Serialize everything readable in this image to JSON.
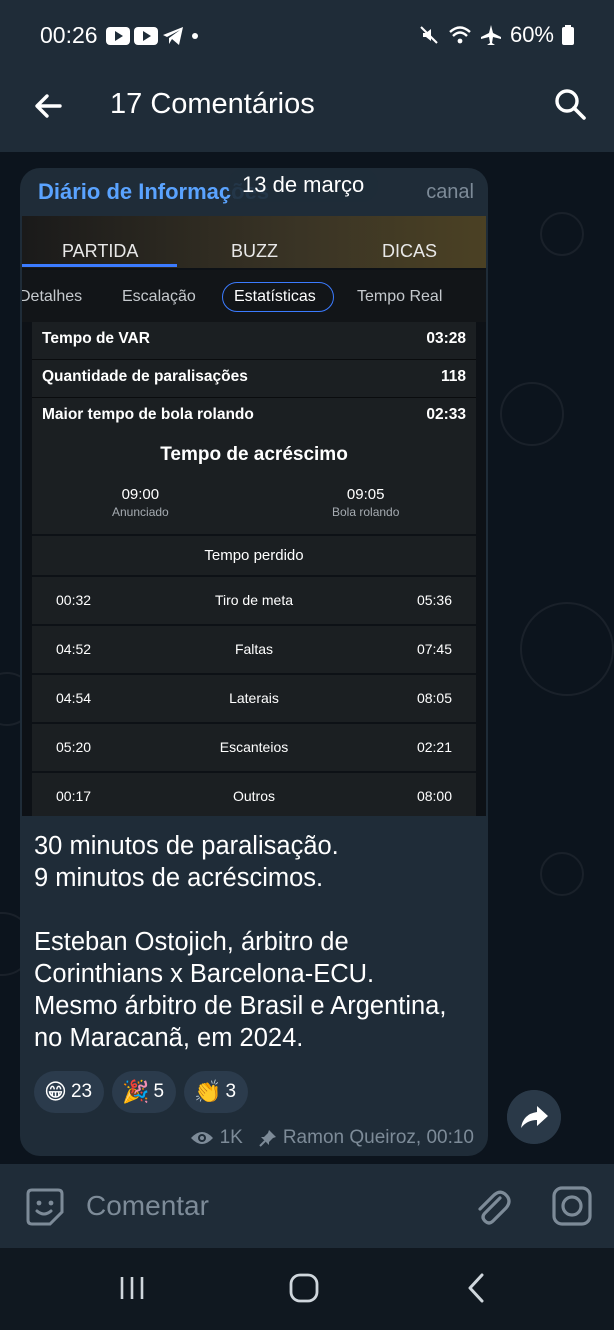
{
  "status_bar": {
    "time": "00:26",
    "battery": "60%"
  },
  "header": {
    "title": "17 Comentários"
  },
  "post": {
    "channel_name": "Diário de Informações",
    "channel_tag": "canal",
    "date_pill": "13 de março",
    "screenshot": {
      "tabs": [
        "PARTIDA",
        "BUZZ",
        "DICAS"
      ],
      "subtabs": [
        "Detalhes",
        "Escalação",
        "Estatísticas",
        "Tempo Real"
      ],
      "stats": [
        {
          "label": "Tempo de VAR",
          "value": "03:28"
        },
        {
          "label": "Quantidade de paralisações",
          "value": "118"
        },
        {
          "label": "Maior tempo de bola rolando",
          "value": "02:33"
        }
      ],
      "extra_title": "Tempo de acréscimo",
      "announced_value": "09:00",
      "announced_label": "Anunciado",
      "rolling_value": "09:05",
      "rolling_label": "Bola rolando",
      "lost_title": "Tempo perdido",
      "lost_rows": [
        {
          "a": "00:32",
          "label": "Tiro de meta",
          "b": "05:36"
        },
        {
          "a": "04:52",
          "label": "Faltas",
          "b": "07:45"
        },
        {
          "a": "04:54",
          "label": "Laterais",
          "b": "08:05"
        },
        {
          "a": "05:20",
          "label": "Escanteios",
          "b": "02:21"
        },
        {
          "a": "00:17",
          "label": "Outros",
          "b": "08:00"
        }
      ]
    },
    "caption": {
      "line1": "30 minutos de paralisação.",
      "line2": "9 minutos de acréscimos.",
      "line3": "Esteban Ostojich, árbitro de",
      "line4": "Corinthians x Barcelona-ECU.",
      "line5": "Mesmo árbitro de Brasil e Argentina,",
      "line6": "no Maracanã, em 2024."
    },
    "reactions": [
      {
        "emoji": "😁",
        "count": "23"
      },
      {
        "emoji": "🎉",
        "count": "5"
      },
      {
        "emoji": "👏",
        "count": "3"
      }
    ],
    "views": "1K",
    "author_time": "Ramon Queiroz, 00:10"
  },
  "input": {
    "placeholder": "Comentar"
  }
}
